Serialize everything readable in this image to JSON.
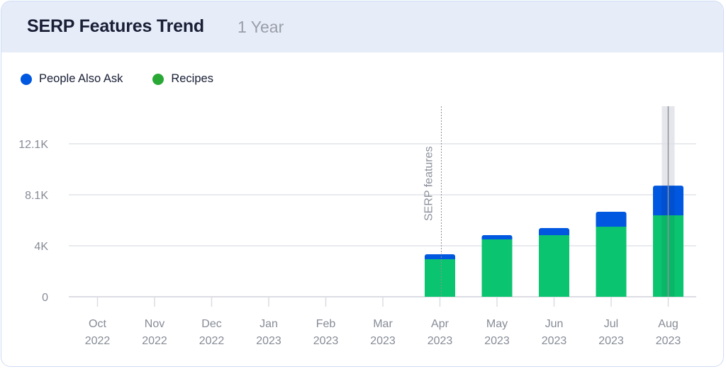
{
  "header": {
    "title": "SERP Features Trend",
    "subtitle": "1 Year"
  },
  "colors": {
    "people_also_ask": "#0057e0",
    "recipes_bar": "#0bc46f",
    "recipes_legend": "#2aa836",
    "grid": "#dcdde3",
    "axis_text": "#868b96"
  },
  "chart_data": {
    "type": "bar",
    "stacked": true,
    "title": "SERP Features Trend",
    "subtitle": "1 Year",
    "xlabel": "",
    "ylabel": "",
    "categories": [
      "Oct|2022",
      "Nov|2022",
      "Dec|2022",
      "Jan|2023",
      "Feb|2023",
      "Mar|2023",
      "Apr|2023",
      "May|2023",
      "Jun|2023",
      "Jul|2023",
      "Aug|2023"
    ],
    "series": [
      {
        "name": "Recipes",
        "key": "recipes",
        "values": [
          0,
          0,
          0,
          0,
          0,
          0,
          2970,
          4540,
          4870,
          5540,
          6440
        ]
      },
      {
        "name": "People Also Ask",
        "key": "people_also_ask",
        "values": [
          0,
          0,
          0,
          0,
          0,
          0,
          390,
          330,
          560,
          1180,
          2350
        ]
      }
    ],
    "legend": [
      {
        "name": "People Also Ask",
        "key": "people_also_ask"
      },
      {
        "name": "Recipes",
        "key": "recipes"
      }
    ],
    "legend_position": "top-left",
    "y_ticks": [
      {
        "value": 0,
        "label": "0"
      },
      {
        "value": 4033,
        "label": "4K"
      },
      {
        "value": 8067,
        "label": "8.1K"
      },
      {
        "value": 12100,
        "label": "12.1K"
      }
    ],
    "ylim": [
      0,
      15000
    ],
    "grid": true,
    "annotation": {
      "label": "SERP features",
      "category_index": 6,
      "style": "dotted-vertical-line"
    },
    "highlighted_category_index": 10
  }
}
